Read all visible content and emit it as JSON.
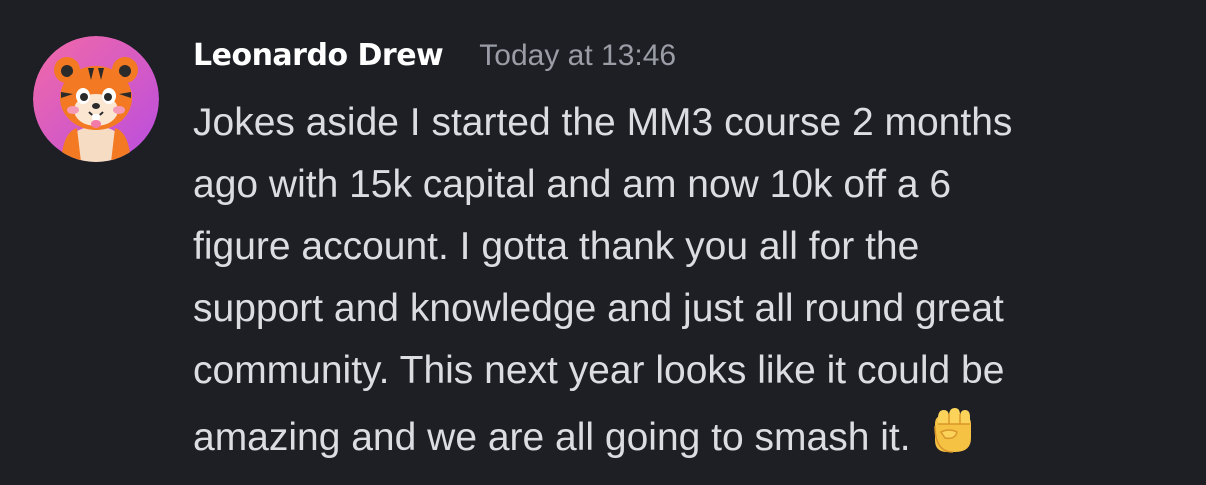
{
  "message": {
    "author": "Leonardo Drew",
    "timestamp": "Today at 13:46",
    "text": "Jokes aside I started the MM3 course 2 months\nago with 15k capital and am now 10k off a 6\nfigure account. I gotta thank you all for the\nsupport and knowledge and just all round great\ncommunity. This next year looks like it could be\namazing and we are all going to smash it.",
    "emoji": "raised-fist-emoji"
  },
  "colors": {
    "background": "#1e1f24",
    "username": "#ffffff",
    "timestamp": "#9a9ca6",
    "text": "#dbdde1",
    "avatar_gradient_start": "#f0529c",
    "avatar_gradient_end": "#c84ad8"
  },
  "icons": {
    "avatar": "tiger-avatar-icon"
  }
}
